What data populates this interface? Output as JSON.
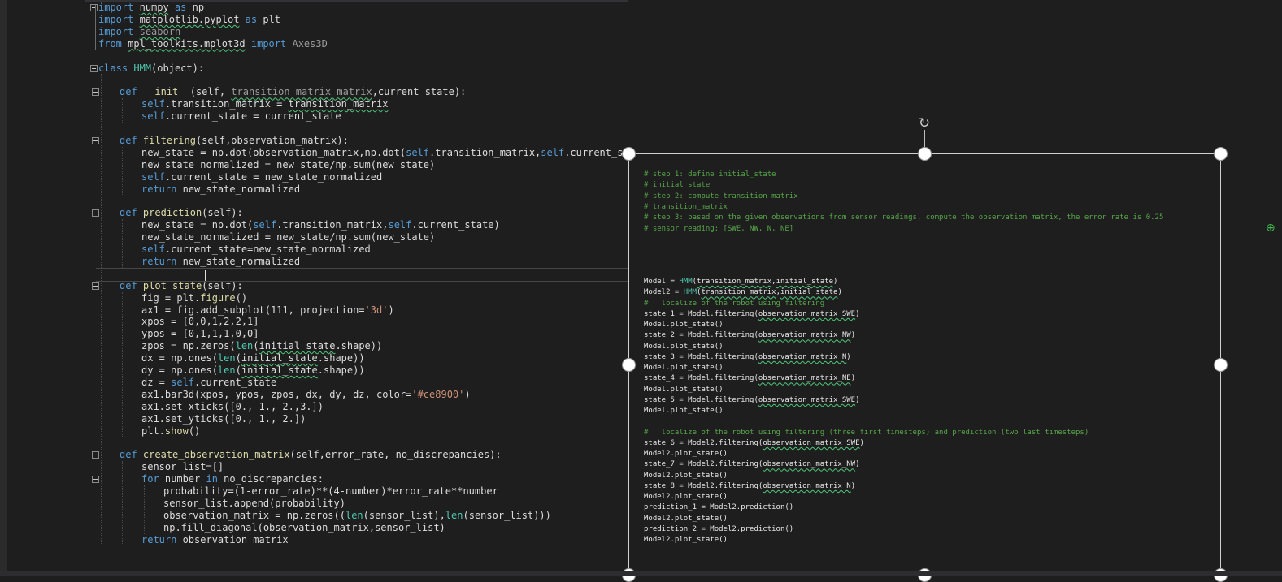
{
  "editor": {
    "lines": [
      [
        [
          "kw",
          "import"
        ],
        [
          "t",
          " "
        ],
        [
          "sq",
          "numpy"
        ],
        [
          "t",
          " "
        ],
        [
          "kw",
          "as"
        ],
        [
          "t",
          " np"
        ]
      ],
      [
        [
          "kw",
          "import"
        ],
        [
          "t",
          " "
        ],
        [
          "sq",
          "matplotlib.pyplot"
        ],
        [
          "t",
          " "
        ],
        [
          "kw",
          "as"
        ],
        [
          "t",
          " plt"
        ]
      ],
      [
        [
          "kw",
          "import"
        ],
        [
          "t",
          " "
        ],
        [
          "sqdim",
          "seaborn"
        ]
      ],
      [
        [
          "kw",
          "from"
        ],
        [
          "t",
          " "
        ],
        [
          "sq",
          "mpl_toolkits.mplot3d"
        ],
        [
          "t",
          " "
        ],
        [
          "kw",
          "import"
        ],
        [
          "t",
          " "
        ],
        [
          "dim",
          "Axes3D"
        ]
      ],
      [],
      [
        [
          "kw",
          "class"
        ],
        [
          "t",
          " "
        ],
        [
          "cls",
          "HMM"
        ],
        [
          "t",
          "(object):"
        ]
      ],
      [],
      [
        [
          "kw",
          "def"
        ],
        [
          "t",
          " "
        ],
        [
          "fn",
          "__init__"
        ],
        [
          "t",
          "(self, "
        ],
        [
          "sqdim",
          "transition_matrix_matrix"
        ],
        [
          "t",
          ",current_state):"
        ]
      ],
      [
        [
          "kw",
          "self"
        ],
        [
          "t",
          ".transition_matrix = "
        ],
        [
          "sq",
          "transition_matrix"
        ]
      ],
      [
        [
          "kw",
          "self"
        ],
        [
          "t",
          ".current_state = current_state"
        ]
      ],
      [],
      [
        [
          "kw",
          "def"
        ],
        [
          "t",
          " "
        ],
        [
          "fn",
          "filtering"
        ],
        [
          "t",
          "(self,observation_matrix):"
        ]
      ],
      [
        [
          "t",
          "new_state = np.dot(observation_matrix,np.dot("
        ],
        [
          "kw",
          "self"
        ],
        [
          "t",
          ".transition_matrix,"
        ],
        [
          "kw",
          "self"
        ],
        [
          "t",
          ".current_state))"
        ]
      ],
      [
        [
          "t",
          "new_state_normalized = new_state/np.sum(new_state)"
        ]
      ],
      [
        [
          "kw",
          "self"
        ],
        [
          "t",
          ".current_state = new_state_normalized"
        ]
      ],
      [
        [
          "kw",
          "return"
        ],
        [
          "t",
          " new_state_normalized"
        ]
      ],
      [],
      [
        [
          "kw",
          "def"
        ],
        [
          "t",
          " "
        ],
        [
          "fn",
          "prediction"
        ],
        [
          "t",
          "(self):"
        ]
      ],
      [
        [
          "t",
          "new_state = np.dot("
        ],
        [
          "kw",
          "self"
        ],
        [
          "t",
          ".transition_matrix,"
        ],
        [
          "kw",
          "self"
        ],
        [
          "t",
          ".current_state)"
        ]
      ],
      [
        [
          "t",
          "new_state_normalized = new_state/np.sum(new_state)"
        ]
      ],
      [
        [
          "kw",
          "self"
        ],
        [
          "t",
          ".current_state=new_state_normalized"
        ]
      ],
      [
        [
          "kw",
          "return"
        ],
        [
          "t",
          " new_state_normalized"
        ]
      ],
      [],
      [
        [
          "kw",
          "def"
        ],
        [
          "t",
          " "
        ],
        [
          "fn",
          "plot_state"
        ],
        [
          "t",
          "(self):"
        ]
      ],
      [
        [
          "t",
          "fig = plt."
        ],
        [
          "fn",
          "figure"
        ],
        [
          "t",
          "()"
        ]
      ],
      [
        [
          "t",
          "ax1 = fig.add_subplot(111, projection="
        ],
        [
          "str",
          "'3d'"
        ],
        [
          "t",
          ")"
        ]
      ],
      [
        [
          "t",
          "xpos = [0,0,1,2,2,1]"
        ]
      ],
      [
        [
          "t",
          "ypos = [0,1,1,1,0,0]"
        ]
      ],
      [
        [
          "t",
          "zpos = np.zeros("
        ],
        [
          "bi",
          "len"
        ],
        [
          "t",
          "("
        ],
        [
          "sq",
          "initial_state"
        ],
        [
          "t",
          ".shape))"
        ]
      ],
      [
        [
          "t",
          "dx = np.ones("
        ],
        [
          "bi",
          "len"
        ],
        [
          "t",
          "("
        ],
        [
          "sq",
          "initial_state"
        ],
        [
          "t",
          ".shape))"
        ]
      ],
      [
        [
          "t",
          "dy = np.ones("
        ],
        [
          "bi",
          "len"
        ],
        [
          "t",
          "("
        ],
        [
          "sq",
          "initial_state"
        ],
        [
          "t",
          ".shape))"
        ]
      ],
      [
        [
          "t",
          "dz = "
        ],
        [
          "kw",
          "self"
        ],
        [
          "t",
          ".current_state"
        ]
      ],
      [
        [
          "t",
          "ax1.bar3d(xpos, ypos, zpos, dx, dy, dz, color="
        ],
        [
          "str",
          "'#ce8900'"
        ],
        [
          "t",
          ")"
        ]
      ],
      [
        [
          "t",
          "ax1.set_xticks([0., 1., 2.,3.])"
        ]
      ],
      [
        [
          "t",
          "ax1.set_yticks([0., 1., 2.])"
        ]
      ],
      [
        [
          "t",
          "plt."
        ],
        [
          "fn",
          "show"
        ],
        [
          "t",
          "()"
        ]
      ],
      [],
      [
        [
          "kw",
          "def"
        ],
        [
          "t",
          " "
        ],
        [
          "fn",
          "create_observation_matrix"
        ],
        [
          "t",
          "(self,error_rate, no_discrepancies):"
        ]
      ],
      [
        [
          "t",
          "sensor_list=[]"
        ]
      ],
      [
        [
          "kw",
          "for"
        ],
        [
          "t",
          " number "
        ],
        [
          "kw",
          "in"
        ],
        [
          "t",
          " no_discrepancies:"
        ]
      ],
      [
        [
          "t",
          "probability=(1-error_rate)**(4-number)*error_rate**number"
        ]
      ],
      [
        [
          "t",
          "sensor_list.append(probability)"
        ]
      ],
      [
        [
          "t",
          "observation_matrix = np.zeros(("
        ],
        [
          "bi",
          "len"
        ],
        [
          "t",
          "(sensor_list),"
        ],
        [
          "bi",
          "len"
        ],
        [
          "t",
          "(sensor_list)))"
        ]
      ],
      [
        [
          "t",
          "np.fill_diagonal(observation_matrix,sensor_list)"
        ]
      ],
      [
        [
          "kw",
          "return"
        ],
        [
          "t",
          " observation_matrix"
        ]
      ]
    ]
  },
  "image": {
    "comments": [
      "# step 1: define initial_state",
      "# initial_state",
      "# step 2: compute transition matrix",
      "# transition_matrix",
      "# step 3: based on the given observations from sensor readings, compute the observation matrix, the error rate is 0.25",
      "# sensor reading: [SWE, NW, N, NE]"
    ],
    "lines": [
      [
        [
          "t",
          "Model = "
        ],
        [
          "c",
          "HMM"
        ],
        [
          "t",
          "("
        ],
        [
          "sq",
          "transition_matrix"
        ],
        [
          "t",
          ","
        ],
        [
          "sq",
          "initial_state"
        ],
        [
          "t",
          ")"
        ]
      ],
      [
        [
          "t",
          "Model2 = "
        ],
        [
          "c",
          "HMM"
        ],
        [
          "t",
          "("
        ],
        [
          "sq",
          "transition_matrix"
        ],
        [
          "t",
          ","
        ],
        [
          "sq",
          "initial_state"
        ],
        [
          "t",
          ")"
        ]
      ],
      [
        [
          "g",
          "#   localize of the robot using filtering"
        ]
      ],
      [
        [
          "t",
          "state_1 = Model.filtering("
        ],
        [
          "sq",
          "observation_matrix_SWE"
        ],
        [
          "t",
          ")"
        ]
      ],
      [
        [
          "t",
          "Model.plot_state()"
        ]
      ],
      [
        [
          "t",
          "state_2 = Model.filtering("
        ],
        [
          "sq",
          "observation_matrix_NW"
        ],
        [
          "t",
          ")"
        ]
      ],
      [
        [
          "t",
          "Model.plot_state()"
        ]
      ],
      [
        [
          "t",
          "state_3 = Model.filtering("
        ],
        [
          "sq",
          "observation_matrix_N"
        ],
        [
          "t",
          ")"
        ]
      ],
      [
        [
          "t",
          "Model.plot_state()"
        ]
      ],
      [
        [
          "t",
          "state_4 = Model.filtering("
        ],
        [
          "sq",
          "observation_matrix_NE"
        ],
        [
          "t",
          ")"
        ]
      ],
      [
        [
          "t",
          "Model.plot_state()"
        ]
      ],
      [
        [
          "t",
          "state_5 = Model.filtering("
        ],
        [
          "sq",
          "observation_matrix_SWE"
        ],
        [
          "t",
          ")"
        ]
      ],
      [
        [
          "t",
          "Model.plot_state()"
        ]
      ],
      [],
      [
        [
          "g",
          "#   localize of the robot using filtering (three first timesteps) and prediction (two last timesteps)"
        ]
      ],
      [
        [
          "t",
          "state_6 = Model2.filtering("
        ],
        [
          "sq",
          "observation_matrix_SWE"
        ],
        [
          "t",
          ")"
        ]
      ],
      [
        [
          "t",
          "Model2.plot_state()"
        ]
      ],
      [
        [
          "t",
          "state_7 = Model2.filtering("
        ],
        [
          "sq",
          "observation_matrix_NW"
        ],
        [
          "t",
          ")"
        ]
      ],
      [
        [
          "t",
          "Model2.plot_state()"
        ]
      ],
      [
        [
          "t",
          "state_8 = Model2.filtering("
        ],
        [
          "sq",
          "observation_matrix_N"
        ],
        [
          "t",
          ")"
        ]
      ],
      [
        [
          "t",
          "Model2.plot_state()"
        ]
      ],
      [
        [
          "t",
          "prediction_1 = Model2.prediction()"
        ]
      ],
      [
        [
          "t",
          "Model2.plot_state()"
        ]
      ],
      [
        [
          "t",
          "prediction_2 = Model2.prediction()"
        ]
      ],
      [
        [
          "t",
          "Model2.plot_state()"
        ]
      ]
    ]
  },
  "icons": {
    "rotate": "rotate-handle-icon",
    "edge": "add-comment-icon"
  }
}
